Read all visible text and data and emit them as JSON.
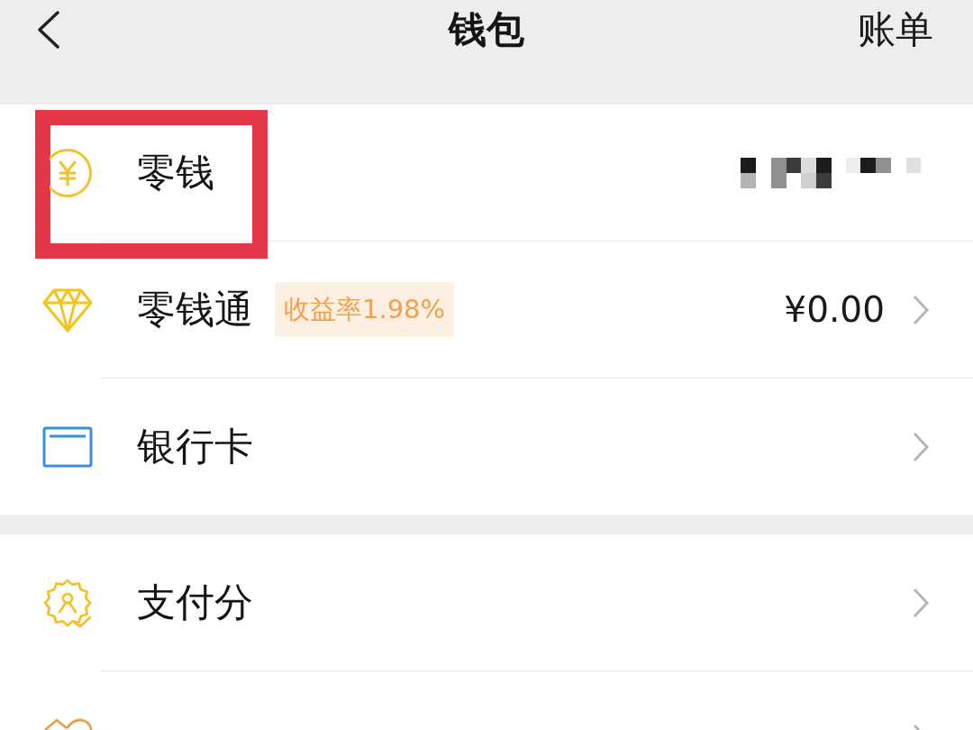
{
  "header": {
    "title": "钱包",
    "action": "账单"
  },
  "sections": [
    {
      "items": [
        {
          "kind": "row",
          "label": "零钱",
          "redacted": true,
          "chevron": false,
          "highlighted": true
        },
        {
          "kind": "row",
          "label": "零钱通",
          "badge": "收益率1.98%",
          "value": "¥0.00",
          "chevron": true,
          "highlighted": false
        },
        {
          "kind": "row",
          "label": "银行卡",
          "chevron": true,
          "highlighted": false
        }
      ]
    },
    {
      "items": [
        {
          "kind": "row",
          "label": "支付分",
          "chevron": true,
          "highlighted": false
        },
        {
          "kind": "clipped_row",
          "chevron": true,
          "highlighted": false
        }
      ]
    }
  ]
}
